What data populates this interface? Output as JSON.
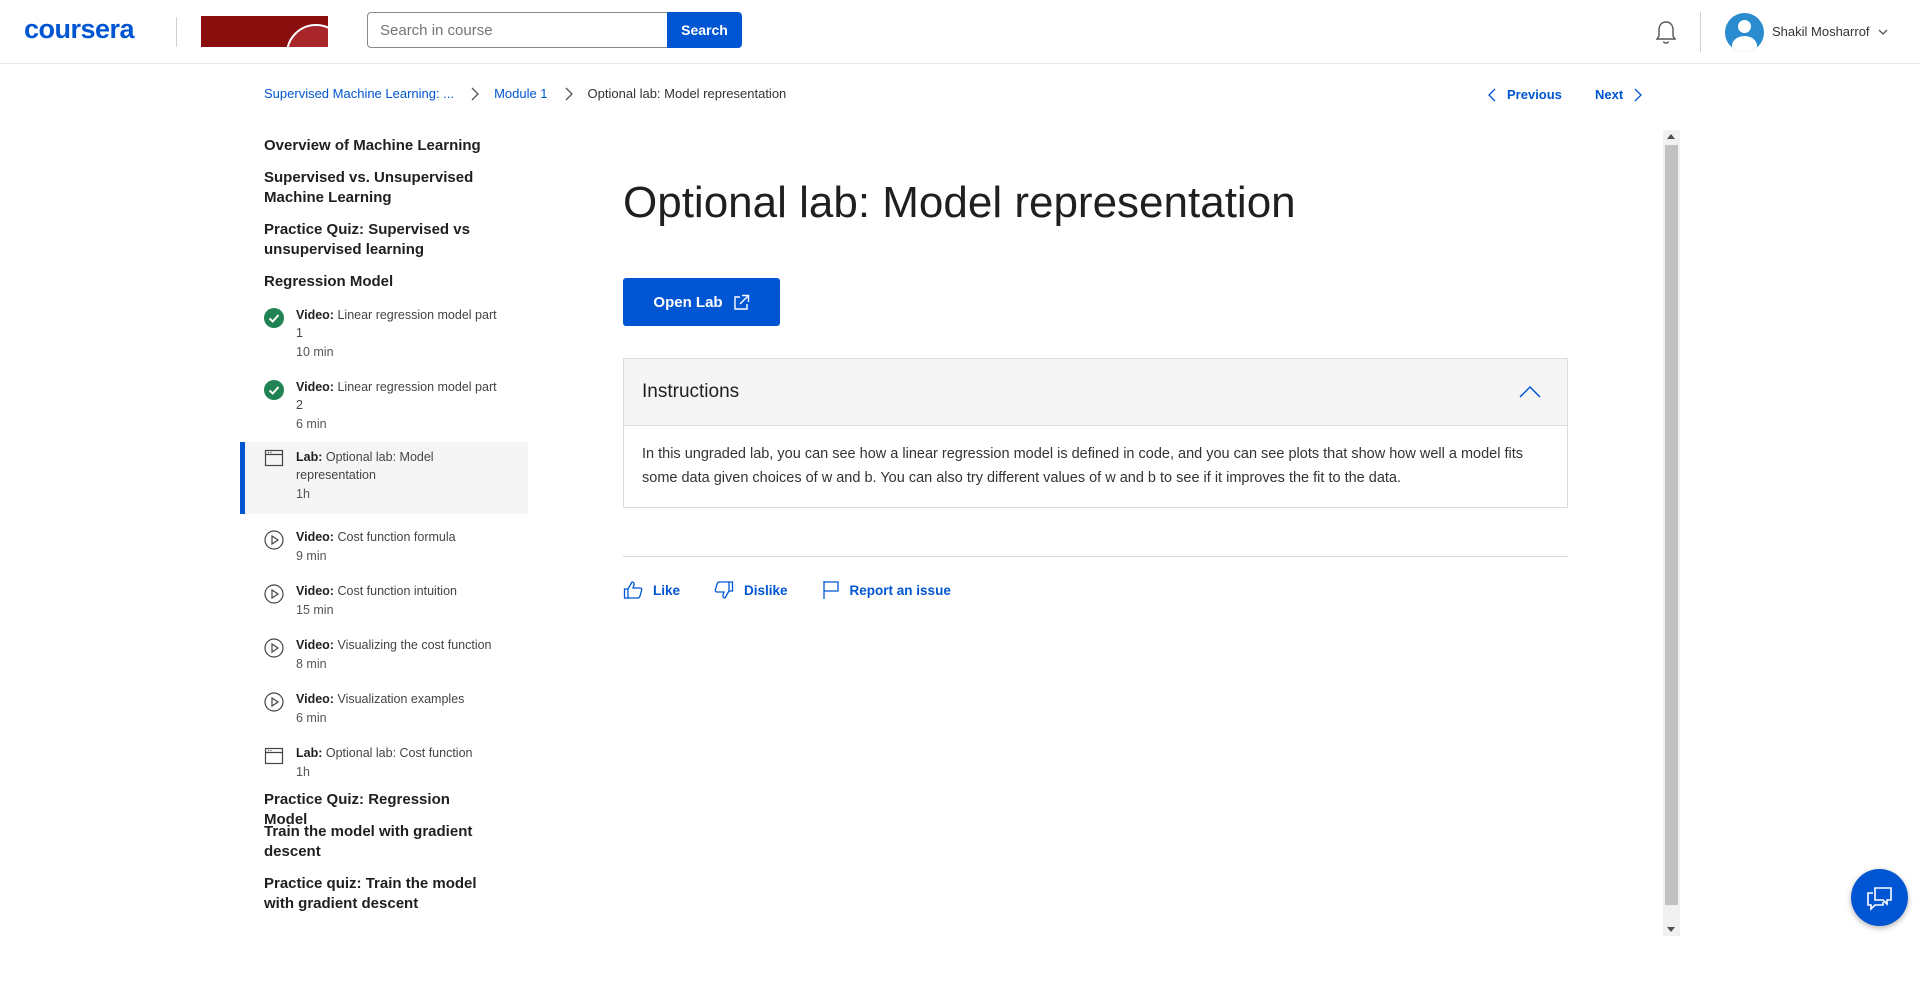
{
  "header": {
    "logo": "coursera",
    "search_placeholder": "Search in course",
    "search_button": "Search",
    "user_name": "Shakil Mosharrof"
  },
  "breadcrumb": {
    "course": "Supervised Machine Learning: ...",
    "module": "Module 1",
    "current": "Optional lab: Model representation"
  },
  "nav": {
    "previous": "Previous",
    "next": "Next"
  },
  "sidebar": {
    "sections": [
      {
        "title": "Overview of Machine Learning"
      },
      {
        "title": "Supervised vs. Unsupervised Machine Learning"
      },
      {
        "title": "Practice Quiz: Supervised vs unsupervised learning"
      },
      {
        "title": "Regression Model"
      },
      {
        "title": "Practice Quiz: Regression Model"
      },
      {
        "title": "Train the model with gradient descent"
      },
      {
        "title": "Practice quiz: Train the model with gradient descent"
      }
    ],
    "items": [
      {
        "kind": "Video:",
        "title": "Linear regression model part 1",
        "duration": "10 min",
        "icon": "completed-check-icon"
      },
      {
        "kind": "Video:",
        "title": "Linear regression model part 2",
        "duration": "6 min",
        "icon": "completed-check-icon"
      },
      {
        "kind": "Lab:",
        "title": "Optional lab: Model representation",
        "duration": "1h",
        "icon": "lab-icon"
      },
      {
        "kind": "Video:",
        "title": "Cost function formula",
        "duration": "9 min",
        "icon": "play-circle-icon"
      },
      {
        "kind": "Video:",
        "title": "Cost function intuition",
        "duration": "15 min",
        "icon": "play-circle-icon"
      },
      {
        "kind": "Video:",
        "title": "Visualizing the cost function",
        "duration": "8 min",
        "icon": "play-circle-icon"
      },
      {
        "kind": "Video:",
        "title": "Visualization examples",
        "duration": "6 min",
        "icon": "play-circle-icon"
      },
      {
        "kind": "Lab:",
        "title": "Optional lab: Cost function",
        "duration": "1h",
        "icon": "lab-icon"
      }
    ]
  },
  "main": {
    "title": "Optional lab: Model representation",
    "open_lab": "Open Lab",
    "instructions_title": "Instructions",
    "instructions_text": "In this ungraded lab, you can see how a linear regression model is defined in code, and you can see plots that show how well a model fits some data given choices of w and b.  You can also try different values of w and b to see if it improves the fit to the data.",
    "like": "Like",
    "dislike": "Dislike",
    "report": "Report an issue"
  },
  "colors": {
    "brand": "#0056d2",
    "completed": "#1f8354",
    "active_bg": "#f5f5f5"
  }
}
